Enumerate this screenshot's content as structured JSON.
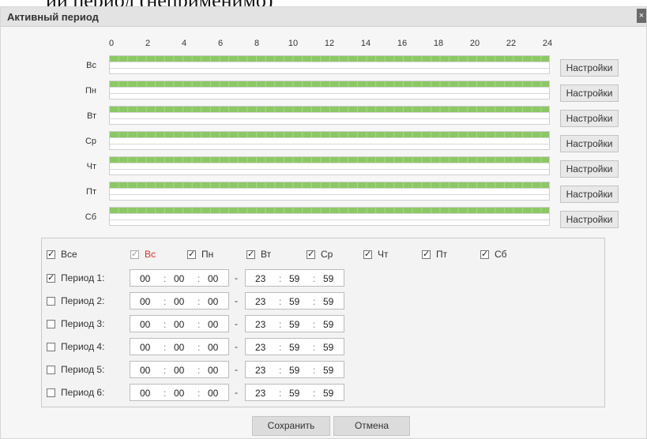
{
  "background_text": "ий период (неприменимо)",
  "dialog": {
    "title": "Активный период",
    "close_label": "×"
  },
  "schedule": {
    "hours": [
      "0",
      "2",
      "4",
      "6",
      "8",
      "10",
      "12",
      "14",
      "16",
      "18",
      "20",
      "22",
      "24"
    ],
    "days": [
      "Вс",
      "Пн",
      "Вт",
      "Ср",
      "Чт",
      "Пт",
      "Сб"
    ],
    "active_fraction": 1.0,
    "settings_label": "Настройки",
    "bar_color": "#8cc865"
  },
  "days_row": {
    "all": {
      "label": "Все",
      "checked": true
    },
    "days": [
      {
        "label": "Вс",
        "checked": true,
        "disabled": true
      },
      {
        "label": "Пн",
        "checked": true
      },
      {
        "label": "Вт",
        "checked": true
      },
      {
        "label": "Ср",
        "checked": true
      },
      {
        "label": "Чт",
        "checked": true
      },
      {
        "label": "Пт",
        "checked": true
      },
      {
        "label": "Сб",
        "checked": true
      }
    ]
  },
  "periods": [
    {
      "label": "Период 1:",
      "checked": true,
      "start": [
        "00",
        "00",
        "00"
      ],
      "end": [
        "23",
        "59",
        "59"
      ]
    },
    {
      "label": "Период 2:",
      "checked": false,
      "start": [
        "00",
        "00",
        "00"
      ],
      "end": [
        "23",
        "59",
        "59"
      ]
    },
    {
      "label": "Период 3:",
      "checked": false,
      "start": [
        "00",
        "00",
        "00"
      ],
      "end": [
        "23",
        "59",
        "59"
      ]
    },
    {
      "label": "Период 4:",
      "checked": false,
      "start": [
        "00",
        "00",
        "00"
      ],
      "end": [
        "23",
        "59",
        "59"
      ]
    },
    {
      "label": "Период 5:",
      "checked": false,
      "start": [
        "00",
        "00",
        "00"
      ],
      "end": [
        "23",
        "59",
        "59"
      ]
    },
    {
      "label": "Период 6:",
      "checked": false,
      "start": [
        "00",
        "00",
        "00"
      ],
      "end": [
        "23",
        "59",
        "59"
      ]
    }
  ],
  "time_separator": ":",
  "range_separator": "-",
  "check_glyph": "✓",
  "buttons": {
    "save": "Сохранить",
    "cancel": "Отмена"
  }
}
